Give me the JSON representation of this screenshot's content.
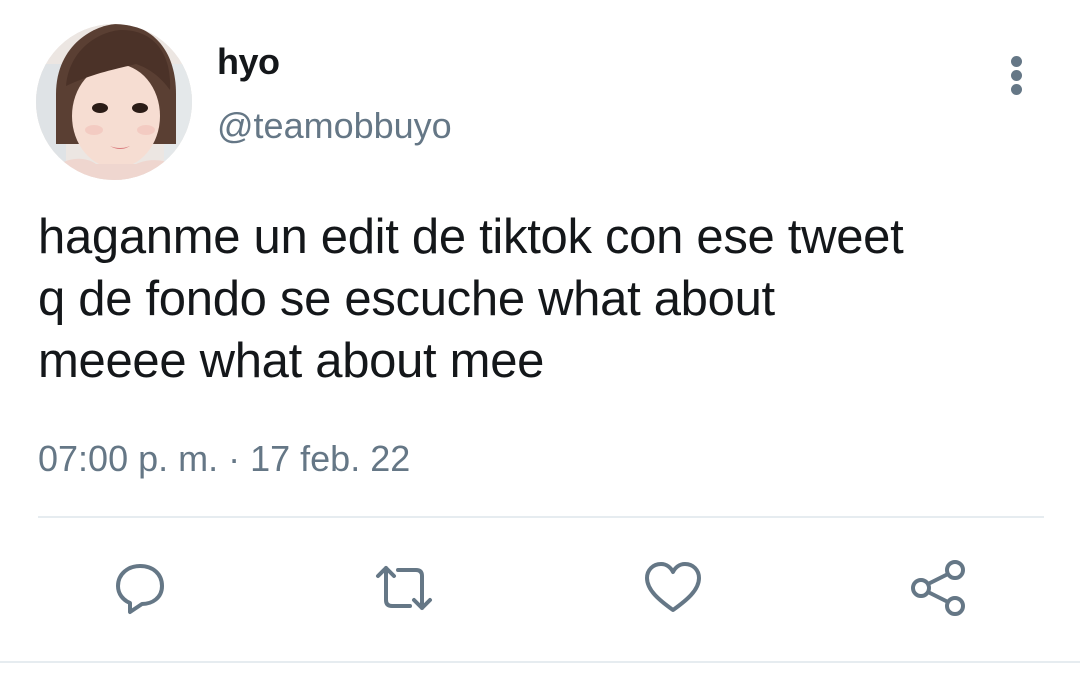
{
  "tweet": {
    "author": {
      "display_name": "hyo",
      "handle": "@teamobbuyo"
    },
    "text": "haganme un edit de tiktok con ese tweet\nq de fondo se escuche what about\nmeeee what about mee",
    "timestamp": "07:00 p. m. · 17 feb. 22"
  },
  "actions": {
    "reply_icon": "reply-icon",
    "retweet_icon": "retweet-icon",
    "like_icon": "heart-icon",
    "share_icon": "share-icon"
  },
  "colors": {
    "text": "#14171a",
    "secondary": "#657786",
    "divider": "#e6ecf0",
    "background": "#ffffff"
  }
}
